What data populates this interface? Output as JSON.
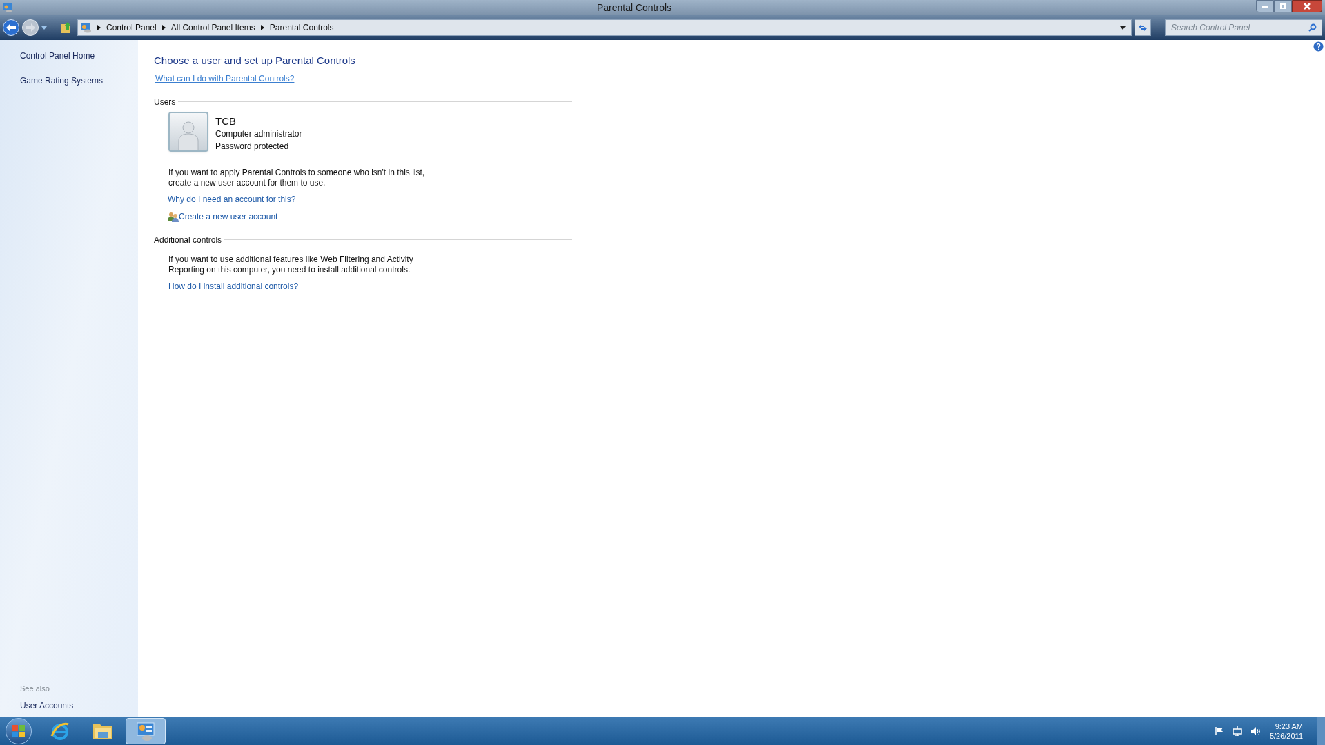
{
  "window": {
    "title": "Parental Controls"
  },
  "address_bar": {
    "breadcrumbs": [
      "Control Panel",
      "All Control Panel Items",
      "Parental Controls"
    ]
  },
  "search": {
    "placeholder": "Search Control Panel"
  },
  "sidebar": {
    "items": [
      "Control Panel Home",
      "Game Rating Systems"
    ],
    "see_also": {
      "heading": "See also",
      "items": [
        "User Accounts"
      ]
    }
  },
  "content": {
    "heading": "Choose a user and set up Parental Controls",
    "help_link": "What can I do with Parental Controls?",
    "users_section": {
      "title": "Users",
      "users": [
        {
          "name": "TCB",
          "role": "Computer administrator",
          "status": "Password protected"
        }
      ],
      "note": "If you want to apply Parental Controls to someone who isn't in this list, create a new user account for them to use.",
      "links": [
        {
          "kind": "plain",
          "text": "Why do I need an account for this?"
        },
        {
          "kind": "icon",
          "text": "Create a new user account"
        }
      ]
    },
    "additional_section": {
      "title": "Additional controls",
      "note": "If you want to use additional features like Web Filtering and Activity Reporting on this computer, you need to install additional controls.",
      "links": [
        {
          "text": "How do I install additional controls?"
        }
      ]
    }
  },
  "taskbar": {
    "items": [
      {
        "kind": "browser",
        "selected": false
      },
      {
        "kind": "folder",
        "selected": false
      },
      {
        "kind": "control-panel",
        "selected": true
      }
    ],
    "clock": {
      "time": "9:23 AM",
      "date": "5/26/2011"
    }
  }
}
